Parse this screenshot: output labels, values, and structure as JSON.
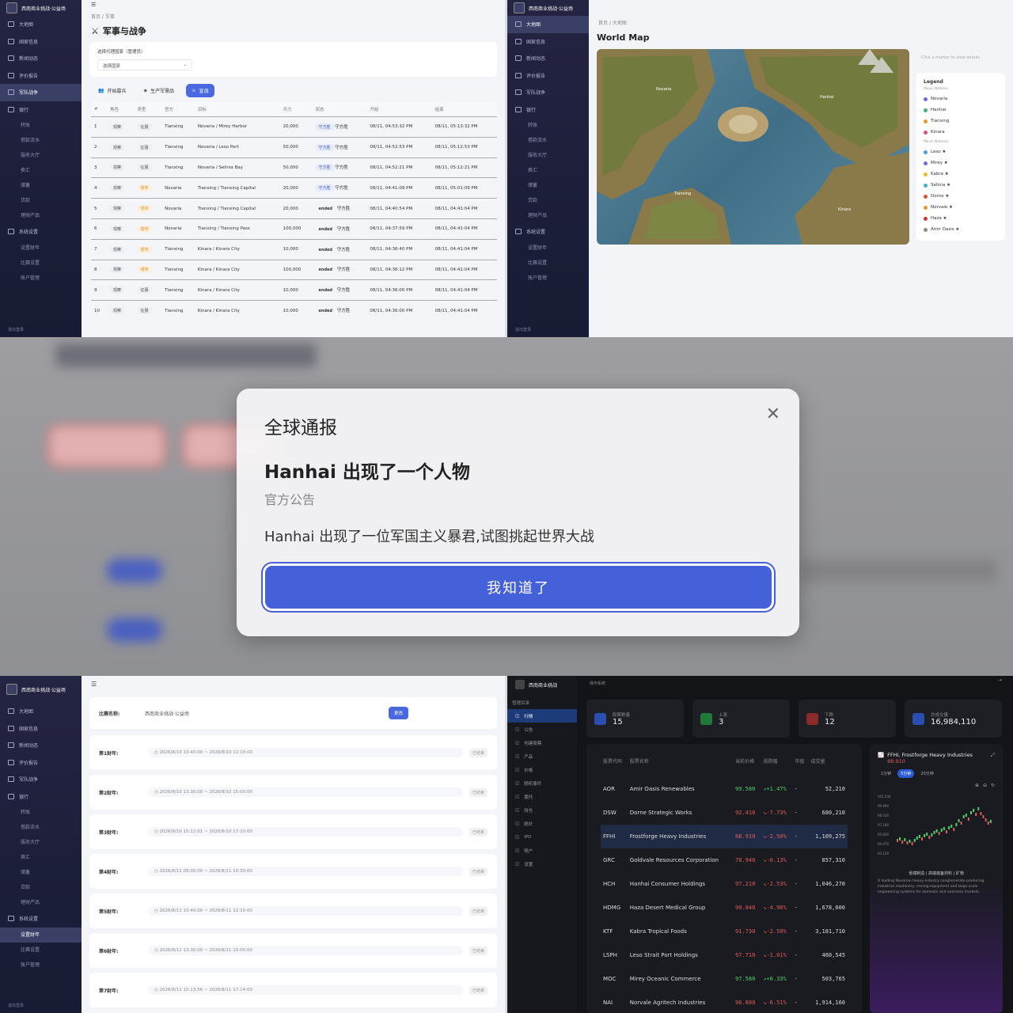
{
  "app_title": "西南商业挑战·公益场",
  "sidebar": {
    "items": [
      "大地图",
      "国家信息",
      "新闻动态",
      "评价报告",
      "军队战争",
      "银行"
    ],
    "bank_subs": [
      "转账",
      "借款流水",
      "服务大厅",
      "换汇",
      "储蓄",
      "贷款",
      "理财产品"
    ],
    "settings": "系统设置",
    "settings_subs": [
      "设置财年",
      "比赛设置",
      "账户管理"
    ],
    "footer": "退出登录"
  },
  "military": {
    "breadcrumb": "首页 / 军事",
    "title": "军事与战争",
    "select_label": "选择代理国家（管理员）",
    "select_placeholder": "选择国家",
    "buttons": [
      "开始募兵",
      "生产军需品",
      "宣战"
    ],
    "headers": [
      "#",
      "角色",
      "类型",
      "官方",
      "目标",
      "兵力",
      "状态",
      "开始",
      "结束"
    ],
    "rows": [
      [
        "1",
        "观察",
        "征服",
        "Tianxing",
        "Novaria / Mirey Harbor",
        "20,000",
        "守方胜",
        "守方胜",
        "08/11, 04:53:32 PM",
        "08/11, 05:13:32 PM"
      ],
      [
        "2",
        "观察",
        "征服",
        "Tianxing",
        "Novaria / Leso Port",
        "50,000",
        "守方胜",
        "守方胜",
        "08/11, 04:52:53 PM",
        "08/11, 05:12:53 PM"
      ],
      [
        "3",
        "观察",
        "征服",
        "Tianxing",
        "Novaria / Selinia Bay",
        "50,000",
        "守方胜",
        "守方胜",
        "08/11, 04:52:21 PM",
        "08/11, 05:12:21 PM"
      ],
      [
        "4",
        "观察",
        "侵夺",
        "Novaria",
        "Tianxing / Tianxing Capital",
        "20,000",
        "守方胜",
        "守方胜",
        "08/11, 04:41:09 PM",
        "08/11, 05:01:09 PM"
      ],
      [
        "5",
        "观察",
        "侵夺",
        "Novaria",
        "Tianxing / Tianxing Capital",
        "20,000",
        "ended",
        "守方胜",
        "08/11, 04:40:54 PM",
        "08/11, 04:41:04 PM"
      ],
      [
        "6",
        "观察",
        "侵夺",
        "Novaria",
        "Tianxing / Tianxing Pass",
        "100,000",
        "ended",
        "守方胜",
        "08/11, 04:37:59 PM",
        "08/11, 04:41:04 PM"
      ],
      [
        "7",
        "观察",
        "侵夺",
        "Tianxing",
        "Kinara / Kinara City",
        "10,000",
        "ended",
        "守方胜",
        "08/11, 04:36:40 PM",
        "08/11, 04:41:04 PM"
      ],
      [
        "8",
        "观察",
        "侵夺",
        "Tianxing",
        "Kinara / Kinara City",
        "100,000",
        "ended",
        "守方胜",
        "08/11, 04:36:12 PM",
        "08/11, 04:41:04 PM"
      ],
      [
        "9",
        "观察",
        "征服",
        "Tianxing",
        "Kinara / Kinara City",
        "10,000",
        "ended",
        "守方胜",
        "08/11, 04:36:00 PM",
        "08/11, 04:41:04 PM"
      ],
      [
        "10",
        "观察",
        "征服",
        "Tianxing",
        "Kinara / Kinara City",
        "10,000",
        "ended",
        "守方胜",
        "08/11, 04:36:00 PM",
        "08/11, 04:41:04 PM"
      ]
    ]
  },
  "map": {
    "breadcrumb": "首页 / 大地图",
    "title": "World Map",
    "hint": "Click a marker to view details",
    "legend_title": "Legend",
    "major_label": "Major Nations",
    "minor_label": "Minor Nations",
    "major": [
      {
        "name": "Novaria",
        "color": "#6a6fd8"
      },
      {
        "name": "Hanhai",
        "color": "#3cb46e"
      },
      {
        "name": "Tianxing",
        "color": "#e89a2c"
      },
      {
        "name": "Kinara",
        "color": "#d84a8a"
      }
    ],
    "minor": [
      {
        "name": "Leso ★",
        "color": "#4aa0e0"
      },
      {
        "name": "Mirey ★",
        "color": "#6a6fd8"
      },
      {
        "name": "Kabra ★",
        "color": "#e8c02c"
      },
      {
        "name": "Selinia ★",
        "color": "#3cb4c8"
      },
      {
        "name": "Dorne ★",
        "color": "#d8542c"
      },
      {
        "name": "Norvale ★",
        "color": "#e89a2c"
      },
      {
        "name": "Haza ★",
        "color": "#c43c3c"
      },
      {
        "name": "Amir Oasis ★",
        "color": "#8a8a8a"
      }
    ],
    "labels": [
      "Novaria",
      "Hanhai",
      "Tianxing",
      "Kinara"
    ]
  },
  "modal": {
    "header": "全球通报",
    "title": "Hanhai 出现了一个人物",
    "source": "官方公告",
    "body": "Hanhai 出现了一位军国主义暴君,试图挑起世界大战",
    "confirm": "我知道了",
    "close_icon": "✕"
  },
  "fiscal": {
    "name_label": "比赛名称:",
    "name_value": "西南商业挑战·公益场",
    "change_btn": "更改",
    "status": "已结束",
    "rows": [
      {
        "label": "第1财年:",
        "range": "2026/8/10 10:40:00 ~ 2026/8/10 12:10:00"
      },
      {
        "label": "第2财年:",
        "range": "2026/8/10 13:30:00 ~ 2026/8/10 15:00:00"
      },
      {
        "label": "第3财年:",
        "range": "2026/8/10 15:12:01 ~ 2026/8/10 17:10:00"
      },
      {
        "label": "第4财年:",
        "range": "2026/8/11 09:00:00 ~ 2026/8/11 10:30:00"
      },
      {
        "label": "第5财年:",
        "range": "2026/8/11 10:40:00 ~ 2026/8/11 12:10:00"
      },
      {
        "label": "第6财年:",
        "range": "2026/8/11 13:30:00 ~ 2026/8/11 15:00:00"
      },
      {
        "label": "第7财年:",
        "range": "2026/8/11 15:13:56 ~ 2026/8/11 17:14:00"
      }
    ]
  },
  "stock": {
    "app": "西南商业挑战",
    "sub": "操作系统",
    "menu_label": "管理目录",
    "menu": [
      "行情",
      "公告",
      "创建股票",
      "产品",
      "价格",
      "随机事件",
      "委托",
      "持仓",
      "統計",
      "IPO",
      "账户",
      "设置"
    ],
    "kpis": [
      {
        "label": "股票数量",
        "value": "15",
        "color": "#2b4fb0"
      },
      {
        "label": "上涨",
        "value": "3",
        "color": "#1f7a3a"
      },
      {
        "label": "下跌",
        "value": "12",
        "color": "#8a2a2a"
      },
      {
        "label": "总成交量",
        "value": "16,984,110",
        "color": "#2b4fb0"
      }
    ],
    "headers": [
      "股票代码",
      "股票名称",
      "当前价格",
      "涨跌幅",
      "市值",
      "成交量"
    ],
    "rows": [
      [
        "AOR",
        "Amir Oasis Renewables",
        "99.580",
        "+1.47%",
        "-",
        "52,210",
        "up"
      ],
      [
        "DSW",
        "Dorne Strategic Works",
        "92.410",
        "-7.73%",
        "-",
        "680,210",
        "dn"
      ],
      [
        "FFHI",
        "Frostforge Heavy Industries",
        "88.910",
        "-2.50%",
        "-",
        "1,109,275",
        "dn"
      ],
      [
        "GRC",
        "Goldvale Resources Corporation",
        "78.940",
        "-0.13%",
        "-",
        "857,310",
        "dn"
      ],
      [
        "HCH",
        "Hanhai Consumer Holdings",
        "97.210",
        "-2.53%",
        "-",
        "1,046,270",
        "dn"
      ],
      [
        "HDMG",
        "Haza Desert Medical Group",
        "90.840",
        "-4.96%",
        "-",
        "1,678,600",
        "dn"
      ],
      [
        "KTF",
        "Kabra Tropical Foods",
        "91.730",
        "-2.50%",
        "-",
        "3,181,710",
        "dn"
      ],
      [
        "LSPH",
        "Leso Strait Port Holdings",
        "97.710",
        "-1.01%",
        "-",
        "460,545",
        "dn"
      ],
      [
        "MOC",
        "Mirey Oceanic Commerce",
        "97.580",
        "+0.33%",
        "-",
        "503,765",
        "up"
      ],
      [
        "NAI",
        "Norvale Agritech Industries",
        "96.880",
        "-6.51%",
        "-",
        "1,914,160",
        "dn"
      ]
    ],
    "detail_title": "FFHI, Frostforge Heavy Industries",
    "detail_price": "88.910",
    "ranges": [
      "1分钟",
      "5分钟",
      "20分钟"
    ],
    "desc_title": "低端制造 | 高端装备材料 | 矿物",
    "desc": "A leading Novarian heavy-industry conglomerate producing industrial machinery, mining equipment and large-scale engineering systems for domestic and overseas markets.",
    "yticks": [
      "101.240",
      "99.890",
      "98.530",
      "97.180",
      "95.830",
      "94.470",
      "93.120"
    ]
  }
}
